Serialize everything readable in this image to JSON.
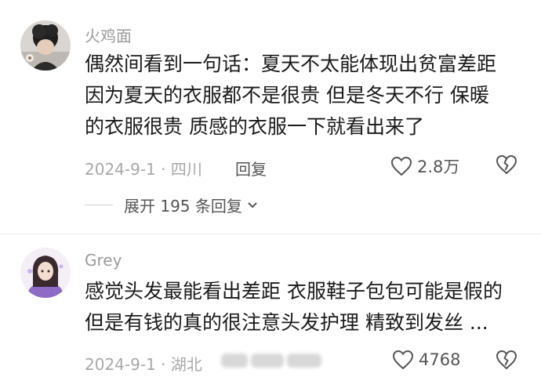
{
  "comments": [
    {
      "username": "火鸡面",
      "lines": [
        "偶然间看到一句话：夏天不太能体现出贫富差距",
        "因为夏天的衣服都不是很贵 但是冬天不行 保暖",
        "的衣服很贵 质感的衣服一下就看出来了"
      ],
      "date_location": "2024-9-1 · 四川",
      "reply_label": "回复",
      "likes": "2.8万",
      "expand_label": "展开 195 条回复"
    },
    {
      "username": "Grey",
      "lines": [
        "感觉头发最能看出差距 衣服鞋子包包可能是假的",
        "但是有钱的真的很注意头发护理 精致到发丝 ..."
      ],
      "date_location": "2024-9-1 · 湖北",
      "likes": "4768"
    }
  ],
  "icons": {
    "like": "heart-outline-icon",
    "dislike": "broken-heart-icon",
    "expand": "chevron-down-icon"
  },
  "colors": {
    "text": "#1a1a1a",
    "meta": "#a8a8a8",
    "action": "#555555"
  }
}
